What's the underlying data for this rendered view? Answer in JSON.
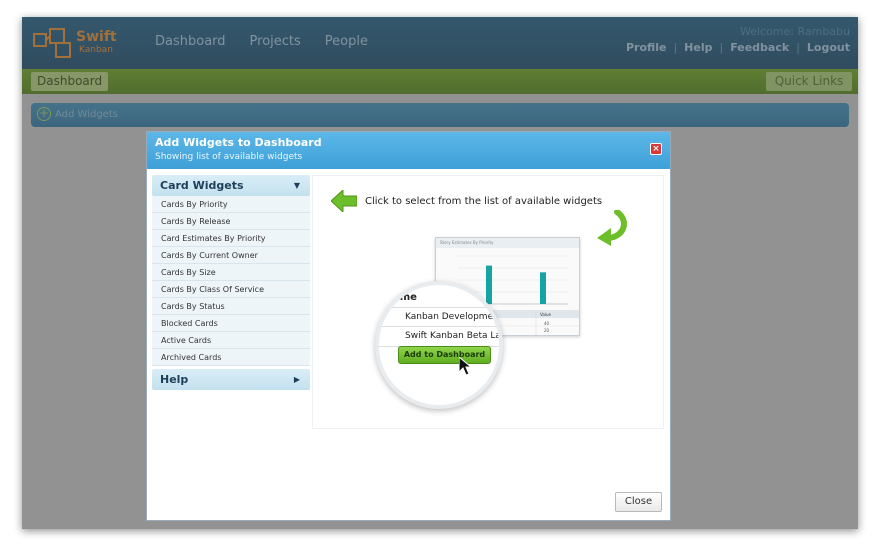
{
  "app": {
    "logo_word": "Swift",
    "logo_sub": "Kanban"
  },
  "nav": {
    "items": [
      "Dashboard",
      "Projects",
      "People"
    ]
  },
  "header": {
    "welcome": "Welcome: Rambabu",
    "links": [
      "Profile",
      "Help",
      "Feedback",
      "Logout"
    ]
  },
  "subnav": {
    "tab": "Dashboard",
    "quick_links": "Quick Links"
  },
  "toolbar": {
    "add_widgets": "Add Widgets"
  },
  "modal": {
    "title": "Add Widgets to Dashboard",
    "subtitle": "Showing list of available widgets",
    "close_icon": "close-icon",
    "sidebar": {
      "card_widgets": "Card Widgets",
      "items": [
        "Cards By Priority",
        "Cards By Release",
        "Card Estimates By Priority",
        "Cards By Current Owner",
        "Cards By Size",
        "Cards By Class Of Service",
        "Cards By Status",
        "Blocked Cards",
        "Active Cards",
        "Archived Cards"
      ],
      "help": "Help"
    },
    "hint": "Click to select from the list of available widgets",
    "preview": {
      "title": "Story Estimates By Priority",
      "col_header": "Value",
      "values": [
        "40",
        "20"
      ],
      "bar_values": [
        40,
        33
      ],
      "ylim": [
        0,
        50
      ]
    },
    "lens": {
      "header": "ame",
      "rows": [
        "Kanban Developme",
        "Swift Kanban Beta La"
      ],
      "button": "Add to Dashboard"
    },
    "close_button": "Close"
  },
  "colors": {
    "topbar": "#1e5f86",
    "greenbar": "#6da51c",
    "modal_header": "#3ea0d8",
    "accent_orange": "#e8892a",
    "bar_teal": "#16a3a3"
  }
}
